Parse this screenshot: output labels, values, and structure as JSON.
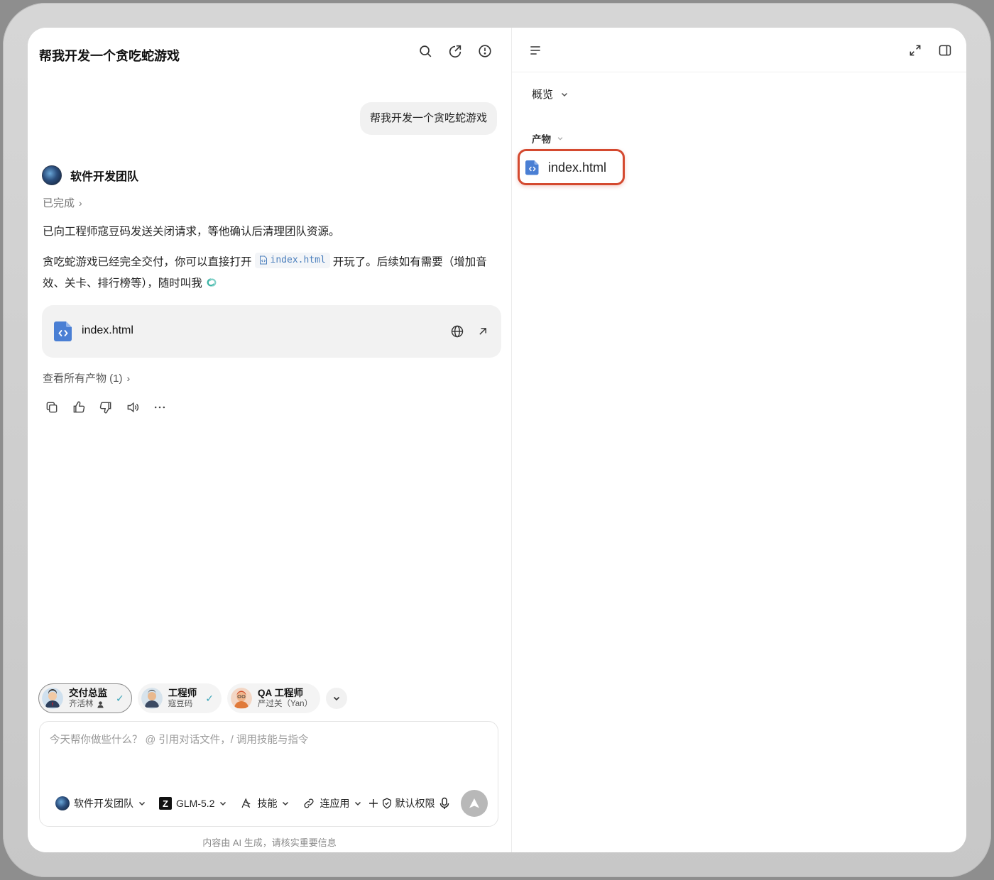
{
  "chat": {
    "title": "帮我开发一个贪吃蛇游戏",
    "user_message": "帮我开发一个贪吃蛇游戏",
    "agent_name": "软件开发团队",
    "status": "已完成",
    "message_1": "已向工程师寇豆码发送关闭请求，等他确认后清理团队资源。",
    "message_2_before": "贪吃蛇游戏已经完全交付，你可以直接打开",
    "message_2_file": "index.html",
    "message_2_after": "开玩了。后续如有需要（增加音效、关卡、排行榜等），随时叫我",
    "file_card_name": "index.html",
    "all_products": "查看所有产物 (1)"
  },
  "agents": [
    {
      "name": "交付总监",
      "sub": "齐活林",
      "selected": true
    },
    {
      "name": "工程师",
      "sub": "寇豆码",
      "selected": false
    },
    {
      "name": "QA 工程师",
      "sub": "严过关（Yan）",
      "selected": false
    }
  ],
  "composer": {
    "placeholder": "今天帮你做些什么？ @ 引用对话文件，/ 调用技能与指令",
    "team": "软件开发团队",
    "model_logo": "Z",
    "model": "GLM-5.2",
    "skills": "技能",
    "connect": "连应用",
    "permission": "默认权限"
  },
  "disclaimer": "内容由 AI 生成，请核实重要信息",
  "panel": {
    "overview": "概览",
    "products_label": "产物",
    "product_file": "index.html"
  },
  "colors": {
    "highlight_border": "#d4492f",
    "file_icon": "#4a7fd4",
    "check": "#3aa5b8"
  },
  "icons": [
    "search-icon",
    "share-icon",
    "history-icon",
    "file-code-icon",
    "globe-icon",
    "open-external-icon",
    "copy-icon",
    "thumbs-up-icon",
    "thumbs-down-icon",
    "speaker-icon",
    "more-icon",
    "menu-icon",
    "expand-icon",
    "sidebar-icon",
    "microphone-icon",
    "send-icon"
  ]
}
